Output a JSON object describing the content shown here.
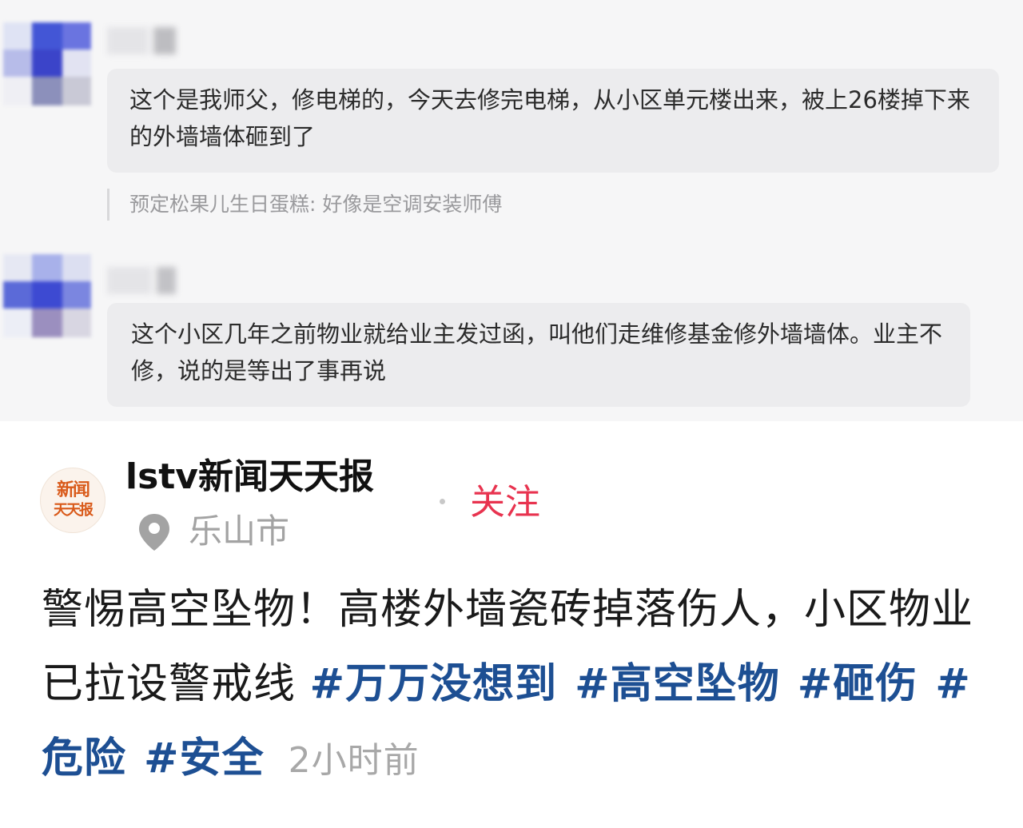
{
  "comments": [
    {
      "text": "这个是我师父，修电梯的，今天去修完电梯，从小区单元楼出来，被上26楼掉下来的外墙墙体砸到了",
      "reply_quote": "预定松果儿生日蛋糕: 好像是空调安装师傅"
    },
    {
      "text": "这个小区几年之前物业就给业主发过函，叫他们走维修基金修外墙墙体。业主不修，说的是等出了事再说"
    }
  ],
  "post": {
    "logo_text_top": "新闻",
    "logo_text_bottom": "天天报",
    "author": "lstv新闻天天报",
    "follow_label": "关注",
    "location": "乐山市",
    "body": "警惕高空坠物！高楼外墙瓷砖掉落伤人，小区物业已拉设警戒线",
    "hashtags": [
      "#万万没想到",
      "#高空坠物",
      "#砸伤",
      "#危险",
      "#安全"
    ],
    "time": "2小时前"
  },
  "colors": {
    "follow": "#e8334f",
    "hashtag": "#1d4f93",
    "muted": "#a3a3a3"
  },
  "icons": {
    "location": "location-pin-icon"
  }
}
